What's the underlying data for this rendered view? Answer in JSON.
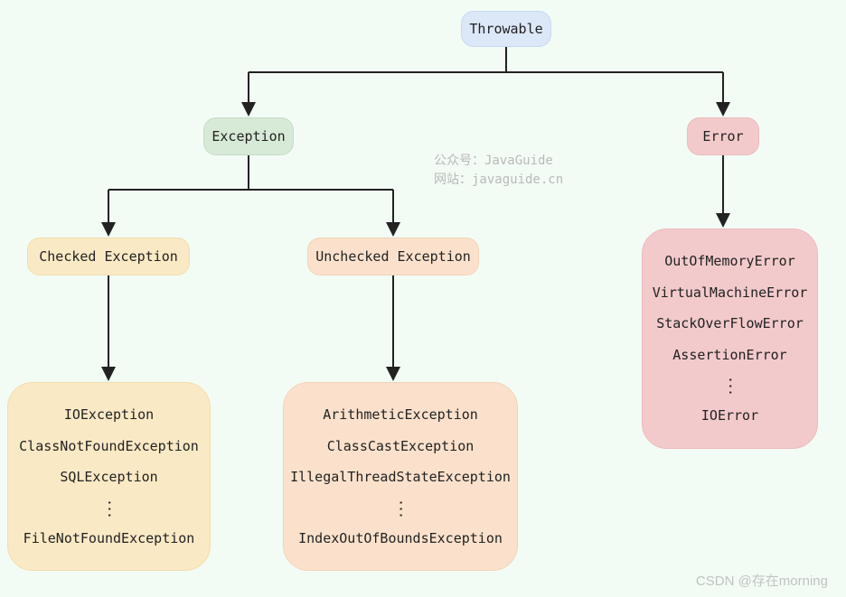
{
  "root": {
    "label": "Throwable"
  },
  "exception": {
    "label": "Exception"
  },
  "error": {
    "label": "Error"
  },
  "checked": {
    "label": "Checked Exception",
    "items": [
      "IOException",
      "ClassNotFoundException",
      "SQLException",
      "⋮",
      "FileNotFoundException"
    ]
  },
  "unchecked": {
    "label": "Unchecked Exception",
    "items": [
      "ArithmeticException",
      "ClassCastException",
      "IllegalThreadStateException",
      "⋮",
      "IndexOutOfBoundsException"
    ]
  },
  "errors": {
    "items": [
      "OutOfMemoryError",
      "VirtualMachineError",
      "StackOverFlowError",
      "AssertionError",
      "⋮",
      "IOError"
    ]
  },
  "watermark": {
    "line1": "公众号：JavaGuide",
    "line2": "网站：javaguide.cn"
  },
  "footer": "CSDN @存在morning"
}
